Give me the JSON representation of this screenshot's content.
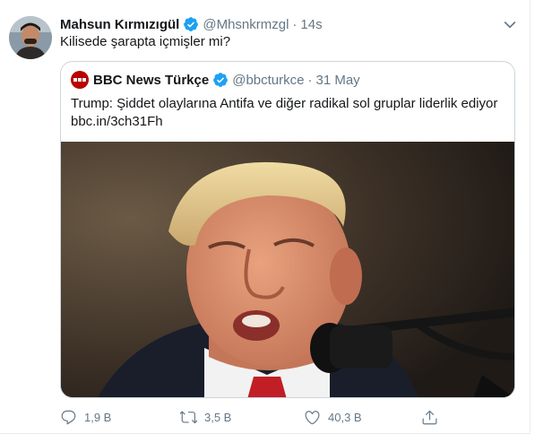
{
  "tweet": {
    "author_name": "Mahsun Kırmızıgül",
    "author_handle": "@Mhsnkrmzgl",
    "separator": "·",
    "time": "14s",
    "text": "Kilisede şarapta içmişler mi?",
    "verified_color": "#1da1f2"
  },
  "quoted": {
    "author_name": "BBC News Türkçe",
    "author_handle": "@bbcturkce",
    "separator": "·",
    "date": "31 May",
    "text": "Trump: Şiddet olaylarına Antifa ve diğer radikal sol gruplar liderlik ediyor",
    "link": "bbc.in/3ch31Fh",
    "logo_brand": "BBC",
    "logo_sub": "NEWS",
    "logo_color": "#b80000"
  },
  "actions": {
    "reply_count": "1,9 B",
    "retweet_count": "3,5 B",
    "like_count": "40,3 B"
  },
  "icons": {
    "verified": "verified-badge-icon",
    "caret": "chevron-down-icon",
    "reply": "reply-icon",
    "retweet": "retweet-icon",
    "like": "heart-icon",
    "share": "share-icon"
  }
}
